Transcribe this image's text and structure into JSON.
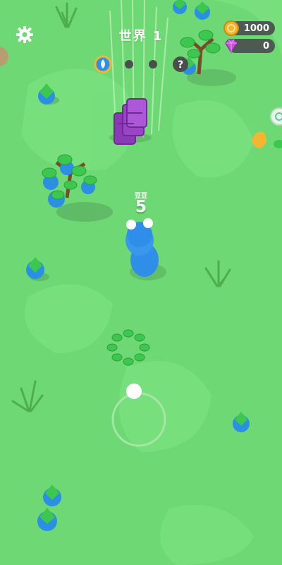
{
  "hud": {
    "world_title": "世界 1",
    "coins": "1000",
    "gems": "0",
    "level_progress": {
      "stages_total": 4,
      "current_stage": 1
    }
  },
  "player": {
    "label": "豆豆",
    "size": "5"
  },
  "colors": {
    "grass": "#6ed874",
    "snake": "#2f8fe8",
    "chest": "#9a44c6",
    "coin": "#f2b632",
    "gem": "#c653d8"
  },
  "icons": {
    "settings": "gear-icon",
    "coin": "coin-icon",
    "gem": "gem-icon",
    "mystery": "question-icon"
  }
}
